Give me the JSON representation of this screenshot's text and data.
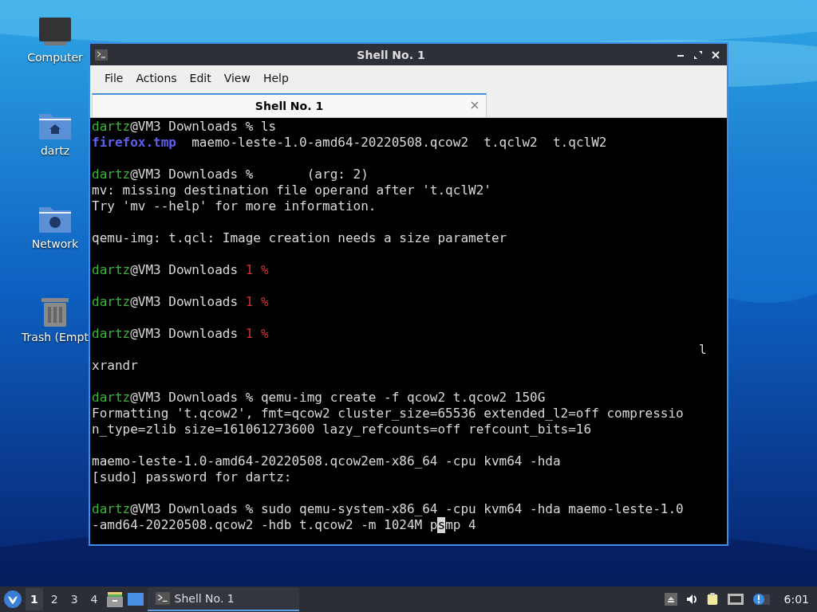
{
  "desktop_icons": [
    {
      "kind": "monitor",
      "label": "Computer"
    },
    {
      "kind": "home",
      "label": "dartz"
    },
    {
      "kind": "network",
      "label": "Network"
    },
    {
      "kind": "trash",
      "label": "Trash (Empt"
    }
  ],
  "window": {
    "title": "Shell No. 1",
    "menu": [
      "File",
      "Actions",
      "Edit",
      "View",
      "Help"
    ],
    "tabs": [
      {
        "label": "Shell No. 1",
        "selected": true
      }
    ],
    "terminal": [
      {
        "kind": "text",
        "segments": [
          {
            "kind": "user",
            "text": "dartz"
          },
          {
            "kind": "plain",
            "text": "@VM3 Downloads % ls"
          }
        ]
      },
      {
        "kind": "text",
        "segments": [
          {
            "kind": "dir",
            "text": "firefox.tmp"
          },
          {
            "kind": "plain",
            "text": "  maemo-leste-1.0-amd64-20220508.qcow2  t.qclw2  t.qclW2"
          }
        ]
      },
      {
        "kind": "blank"
      },
      {
        "kind": "text",
        "segments": [
          {
            "kind": "user",
            "text": "dartz"
          },
          {
            "kind": "plain",
            "text": "@VM3 Downloads %       (arg: 2)"
          }
        ]
      },
      {
        "kind": "text",
        "segments": [
          {
            "kind": "plain",
            "text": "mv: missing destination file operand after 't.qclW2'"
          }
        ]
      },
      {
        "kind": "text",
        "segments": [
          {
            "kind": "plain",
            "text": "Try 'mv --help' for more information."
          }
        ]
      },
      {
        "kind": "blank"
      },
      {
        "kind": "text",
        "segments": [
          {
            "kind": "plain",
            "text": "qemu-img: t.qcl: Image creation needs a size parameter"
          }
        ]
      },
      {
        "kind": "blank"
      },
      {
        "kind": "text",
        "segments": [
          {
            "kind": "user",
            "text": "dartz"
          },
          {
            "kind": "plain",
            "text": "@VM3 Downloads "
          },
          {
            "kind": "error",
            "text": "1 %"
          }
        ]
      },
      {
        "kind": "blank"
      },
      {
        "kind": "text",
        "segments": [
          {
            "kind": "user",
            "text": "dartz"
          },
          {
            "kind": "plain",
            "text": "@VM3 Downloads "
          },
          {
            "kind": "error",
            "text": "1 %"
          }
        ]
      },
      {
        "kind": "blank"
      },
      {
        "kind": "text",
        "segments": [
          {
            "kind": "user",
            "text": "dartz"
          },
          {
            "kind": "plain",
            "text": "@VM3 Downloads "
          },
          {
            "kind": "error",
            "text": "1 %"
          }
        ]
      },
      {
        "kind": "text",
        "segments": [
          {
            "kind": "plain",
            "text": "                                                                               l"
          }
        ]
      },
      {
        "kind": "text",
        "segments": [
          {
            "kind": "plain",
            "text": "xrandr"
          }
        ]
      },
      {
        "kind": "blank"
      },
      {
        "kind": "text",
        "segments": [
          {
            "kind": "user",
            "text": "dartz"
          },
          {
            "kind": "plain",
            "text": "@VM3 Downloads % qemu-img create -f qcow2 t.qcow2 150G"
          }
        ]
      },
      {
        "kind": "text",
        "segments": [
          {
            "kind": "plain",
            "text": "Formatting 't.qcow2', fmt=qcow2 cluster_size=65536 extended_l2=off compressio"
          }
        ]
      },
      {
        "kind": "text",
        "segments": [
          {
            "kind": "plain",
            "text": "n_type=zlib size=161061273600 lazy_refcounts=off refcount_bits=16"
          }
        ]
      },
      {
        "kind": "blank"
      },
      {
        "kind": "text",
        "segments": [
          {
            "kind": "plain",
            "text": "maemo-leste-1.0-amd64-20220508.qcow2em-x86_64 -cpu kvm64 -hda"
          }
        ]
      },
      {
        "kind": "text",
        "segments": [
          {
            "kind": "plain",
            "text": "[sudo] password for dartz:"
          }
        ]
      },
      {
        "kind": "blank"
      },
      {
        "kind": "text",
        "segments": [
          {
            "kind": "user",
            "text": "dartz"
          },
          {
            "kind": "plain",
            "text": "@VM3 Downloads % sudo qemu-system-x86_64 -cpu kvm64 -hda maemo-leste-1.0"
          }
        ]
      },
      {
        "kind": "text",
        "segments": [
          {
            "kind": "plain",
            "text": "-amd64-20220508.qcow2 -hdb t.qcow2 -m 1024M p"
          },
          {
            "kind": "cursor",
            "text": "s"
          },
          {
            "kind": "plain",
            "text": "mp 4"
          }
        ]
      }
    ]
  },
  "taskbar": {
    "workspaces": [
      {
        "label": "1",
        "selected": true
      },
      {
        "label": "2",
        "selected": false
      },
      {
        "label": "3",
        "selected": false
      },
      {
        "label": "4",
        "selected": false
      }
    ],
    "tasks": [
      {
        "label": "Shell No. 1",
        "selected": true
      }
    ],
    "tray": [
      {
        "kind": "eject"
      },
      {
        "kind": "volume"
      },
      {
        "kind": "clipboard"
      },
      {
        "kind": "network"
      },
      {
        "kind": "notification"
      }
    ],
    "clock": "6:01"
  }
}
